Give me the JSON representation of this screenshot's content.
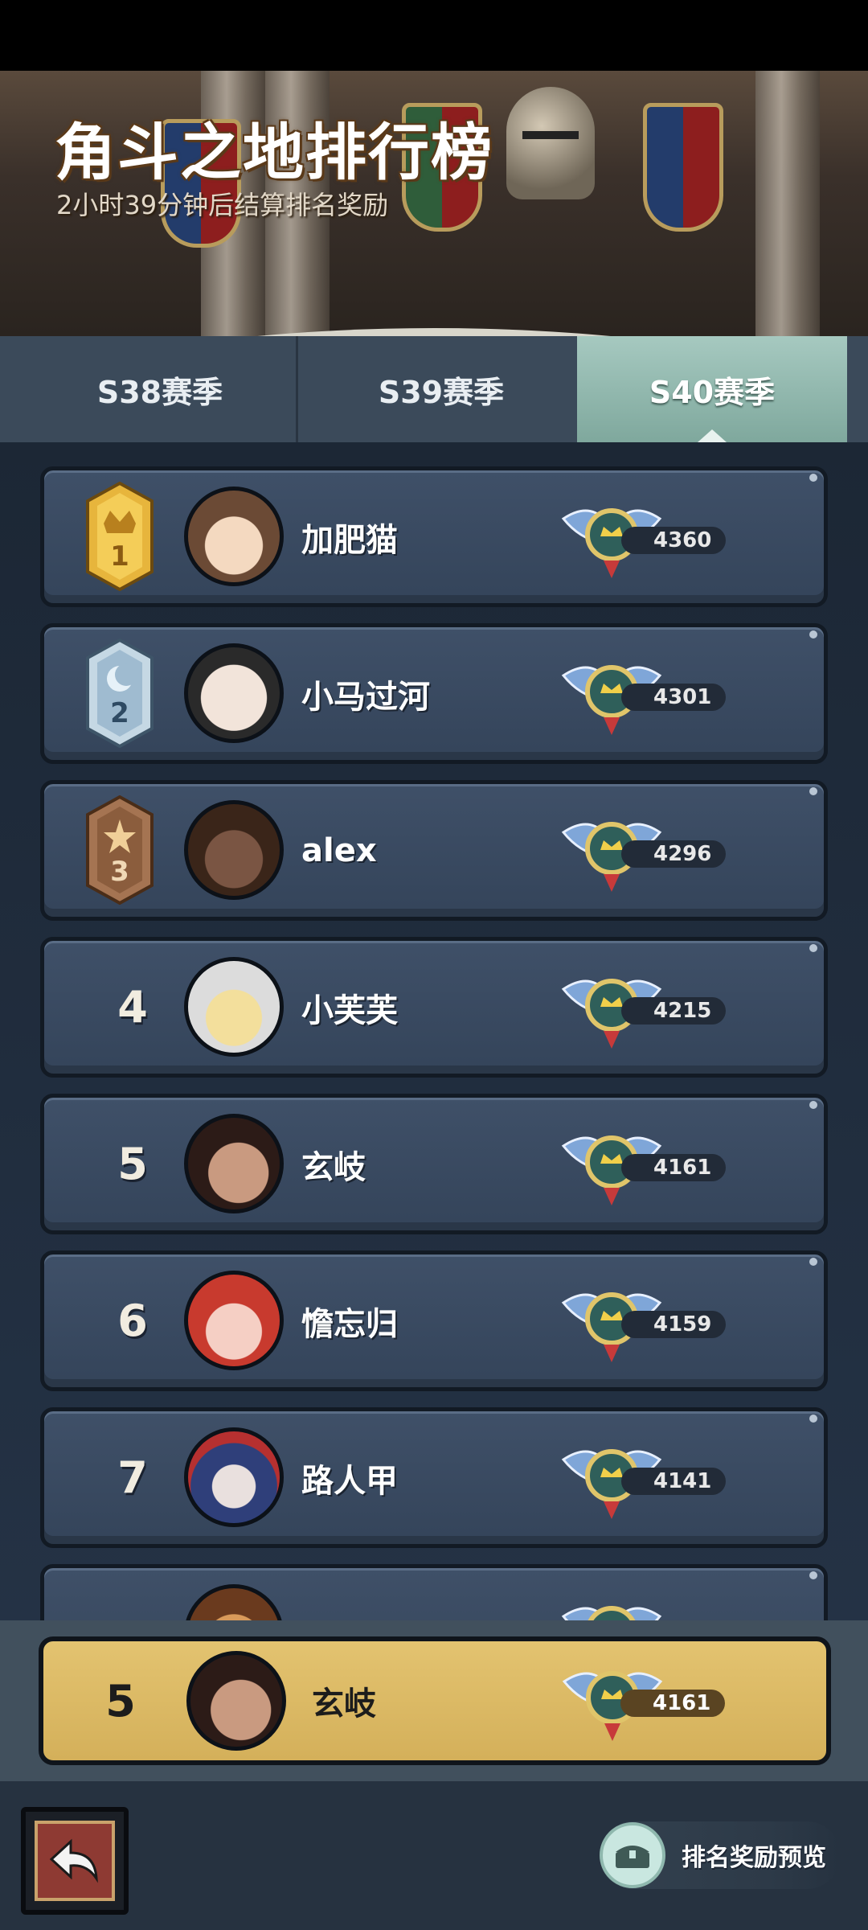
{
  "banner": {
    "title": "角斗之地排行榜",
    "subtitle": "2小时39分钟后结算排名奖励"
  },
  "tabs": [
    {
      "label": "S38赛季",
      "active": false
    },
    {
      "label": "S39赛季",
      "active": false
    },
    {
      "label": "S40赛季",
      "active": true
    }
  ],
  "leaderboard": [
    {
      "rank": "1",
      "name": "加肥猫",
      "score": "4360",
      "badge": "gold-crown-badge",
      "avatar_color": "#c9a37a"
    },
    {
      "rank": "2",
      "name": "小马过河",
      "score": "4301",
      "badge": "silver-moon-badge",
      "avatar_color": "#e8d8cc"
    },
    {
      "rank": "3",
      "name": "alex",
      "score": "4296",
      "badge": "bronze-star-badge",
      "avatar_color": "#5a3b2b"
    },
    {
      "rank": "4",
      "name": "小芙芙",
      "score": "4215",
      "badge": null,
      "avatar_color": "#efe3c0"
    },
    {
      "rank": "5",
      "name": "玄岐",
      "score": "4161",
      "badge": null,
      "avatar_color": "#6a3f34"
    },
    {
      "rank": "6",
      "name": "憺忘归",
      "score": "4159",
      "badge": null,
      "avatar_color": "#d84a3c"
    },
    {
      "rank": "7",
      "name": "路人甲",
      "score": "4141",
      "badge": null,
      "avatar_color": "#3a4f8a"
    }
  ],
  "my_rank": {
    "rank": "5",
    "name": "玄岐",
    "score": "4161"
  },
  "bottom": {
    "back_icon": "back-arrow-icon",
    "reward_preview_label": "排名奖励预览"
  },
  "colors": {
    "row_bg": "#3f5068",
    "my_row_bg": "#e3c370",
    "active_tab": "#a6c9c0"
  }
}
